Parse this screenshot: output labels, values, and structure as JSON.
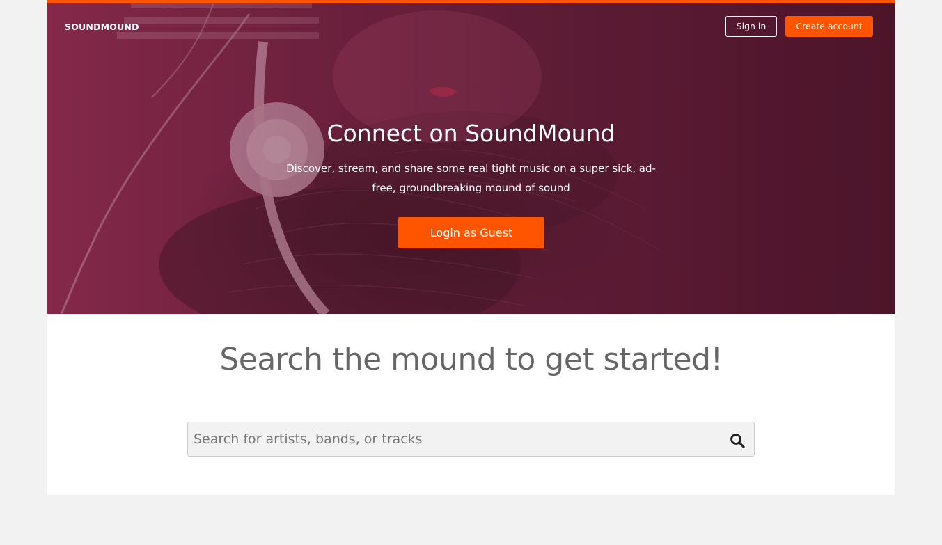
{
  "colors": {
    "accent": "#ff5500",
    "hero_overlay": "#6e2240",
    "page_background": "#f2f2f2",
    "heading_gray": "#666666"
  },
  "header": {
    "logo_text": "SOUNDMOUND",
    "sign_in_label": "Sign in",
    "create_account_label": "Create account"
  },
  "hero": {
    "title": "Connect on SoundMound",
    "subtitle": "Discover, stream, and share some real tight music on a super sick, ad-free, groundbreaking mound of sound",
    "guest_button_label": "Login as Guest",
    "image": "woman-with-headphones"
  },
  "search": {
    "heading": "Search the mound to get started!",
    "placeholder": "Search for artists, bands, or tracks",
    "value": "",
    "icon": "search-icon"
  }
}
